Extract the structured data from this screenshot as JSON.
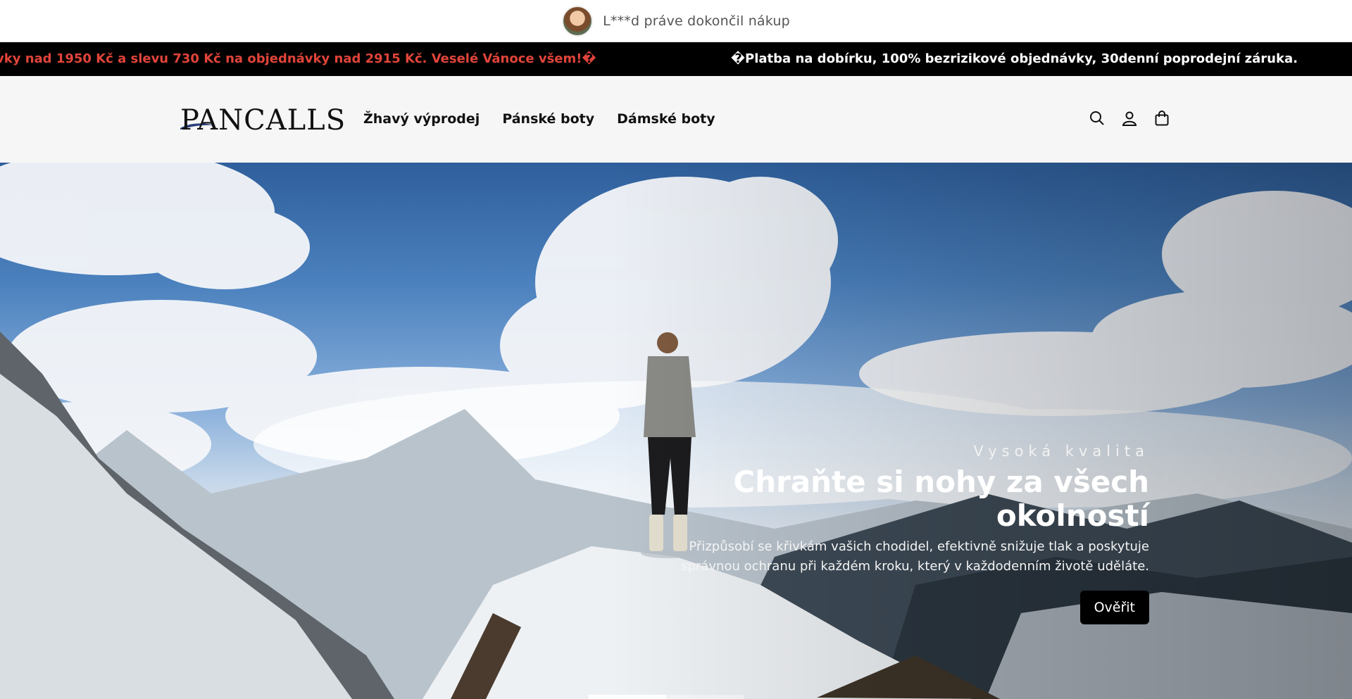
{
  "notification": {
    "text": "L***d práve dokončil nákup"
  },
  "ticker": {
    "promo_text": "vky nad 1950 Kč a slevu 730 Kč na objednávky nad 2915 Kč. Veselé Vánoce všem!�",
    "info_text": "�Platba na dobírku, 100% bezrizikové objednávky, 30denní poprodejní záruka.",
    "promo_color": "#e0443a"
  },
  "header": {
    "logo": "PANCALLS",
    "nav": [
      {
        "label": "Žhavý výprodej"
      },
      {
        "label": "Pánské boty"
      },
      {
        "label": "Dámské boty"
      }
    ],
    "icons": [
      "search-icon",
      "account-icon",
      "cart-icon"
    ]
  },
  "hero": {
    "eyebrow": "Vysoká kvalita",
    "title_line1": "Chraňte si nohy za všech",
    "title_line2": "okolností",
    "desc_line1": "Přizpůsobí se křivkám vašich chodidel, efektivně snižuje tlak a poskytuje",
    "desc_line2": "správnou ochranu při každém kroku, který v každodenním životě uděláte.",
    "button_label": "Ověřit",
    "slides_total": 2,
    "active_slide": 1
  }
}
